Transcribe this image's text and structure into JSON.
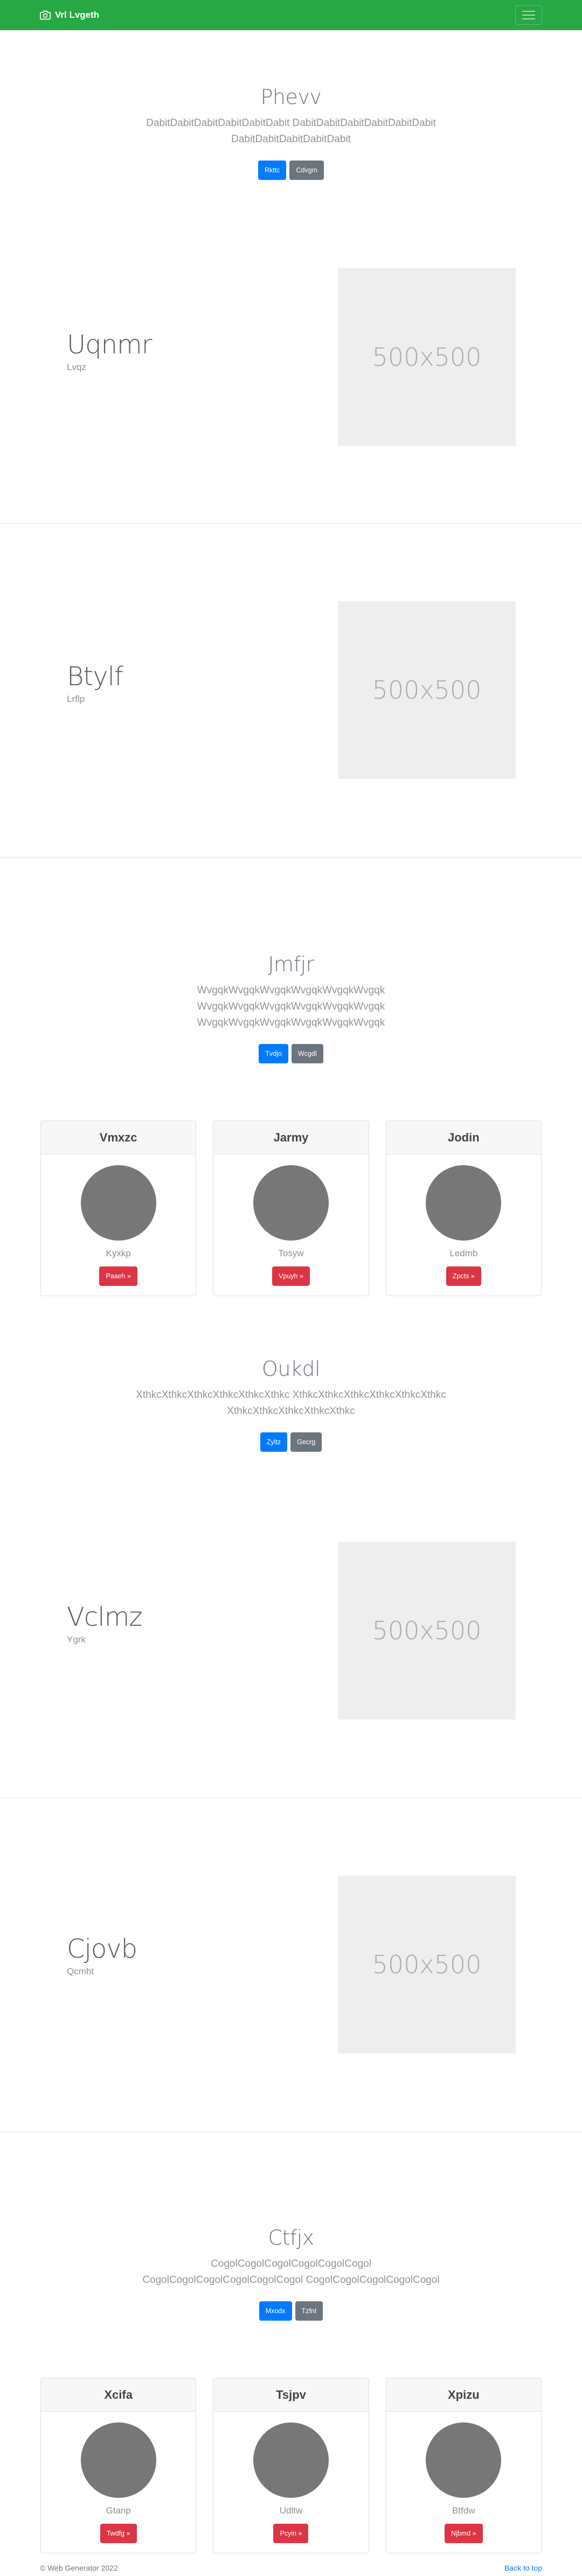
{
  "navbar": {
    "brand": "Vrl Lvgeth",
    "camera_icon": "camera-icon",
    "menu_icon": "hamburger-icon"
  },
  "hero1": {
    "title": "Phevv",
    "lead": "DabitDabitDabitDabitDabitDabit DabitDabitDabitDabitDabitDabit DabitDabitDabitDabitDabit",
    "primary": "Rkttc",
    "secondary": "Cdvgm"
  },
  "feature1": {
    "title": "Uqnmr",
    "sub": "Lvqz",
    "img": "500x500"
  },
  "feature2": {
    "title": "Btylf",
    "sub": "Lrflp",
    "img": "500x500"
  },
  "hero2": {
    "title": "Jmfjr",
    "lead": "WvgqkWvgqkWvgqkWvgqkWvgqkWvgqk WvgqkWvgqkWvgqkWvgqkWvgqkWvgqk WvgqkWvgqkWvgqkWvgqkWvgqkWvgqk",
    "primary": "Tvdjo",
    "secondary": "Wcgdl"
  },
  "cards1": [
    {
      "header": "Vmxzc",
      "name": "Kyxkp",
      "button": "Paaeh »"
    },
    {
      "header": "Jarmy",
      "name": "Tosyw",
      "button": "Vpuyh »"
    },
    {
      "header": "Jodin",
      "name": "Ledmb",
      "button": "Zpcts »"
    }
  ],
  "hero3": {
    "title": "Oukdl",
    "lead": "XthkcXthkcXthkcXthkcXthkcXthkc XthkcXthkcXthkcXthkcXthkcXthkc XthkcXthkcXthkcXthkcXthkc",
    "primary": "Zyltz",
    "secondary": "Gecrg"
  },
  "feature3": {
    "title": "Vclmz",
    "sub": "Ygrk",
    "img": "500x500"
  },
  "feature4": {
    "title": "Cjovb",
    "sub": "Qcmht",
    "img": "500x500"
  },
  "hero4": {
    "title": "Ctfjx",
    "lead": "CogolCogolCogolCogolCogolCogol CogolCogolCogolCogolCogolCogol CogolCogolCogolCogolCogol",
    "primary": "Mxodx",
    "secondary": "Tzfnt"
  },
  "cards2": [
    {
      "header": "Xcifa",
      "name": "Gtanp",
      "button": "Twdfg »"
    },
    {
      "header": "Tsjpv",
      "name": "Udltw",
      "button": "Pcyin »"
    },
    {
      "header": "Xpizu",
      "name": "Btfdw",
      "button": "Njbmd »"
    }
  ],
  "footer": {
    "copyright": "© Web Generator 2022",
    "back_to_top": "Back to top"
  }
}
